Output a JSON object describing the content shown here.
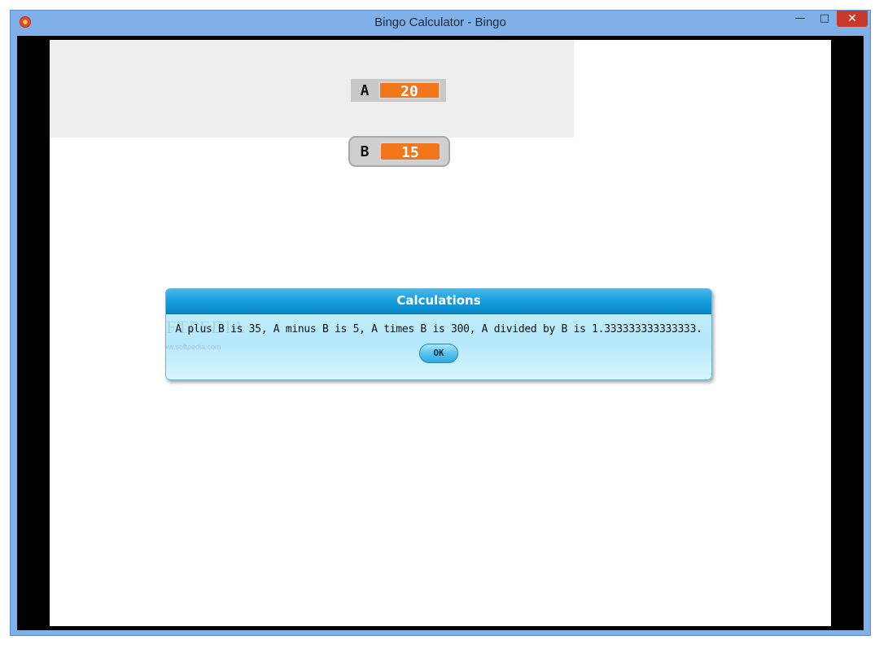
{
  "window": {
    "title": "Bingo Calculator - Bingo",
    "icon": "bingo-app-icon",
    "controls": {
      "minimize": "—",
      "maximize": "□",
      "close": "✕"
    }
  },
  "variables": [
    {
      "name": "A",
      "value": "20"
    },
    {
      "name": "B",
      "value": "15"
    }
  ],
  "dialog": {
    "title": "Calculations",
    "message": "A plus B is 35, A minus B is 5, A times B is 300, A divided by B is 1.333333333333333.",
    "ok_label": "OK"
  },
  "watermark": {
    "text": "SOFTPEDIA",
    "url": "www.softpedia.com"
  },
  "colors": {
    "value_fill": "#f2761b",
    "dialog_header": "#129ad9",
    "window_frame": "#7fb0e8",
    "close_button": "#c7392b"
  }
}
